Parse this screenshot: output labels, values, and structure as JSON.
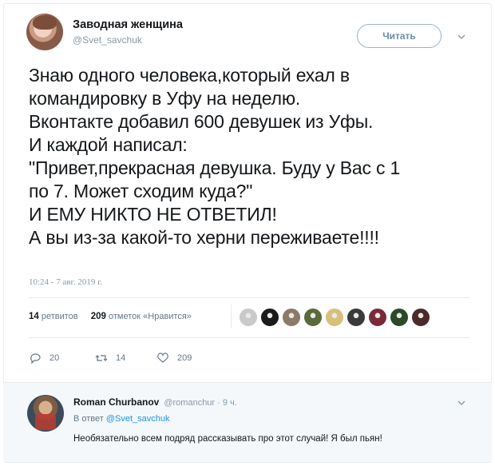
{
  "tweet": {
    "author": {
      "name": "Заводная женщина",
      "handle": "@Svet_savchuk"
    },
    "follow_label": "Читать",
    "text_lines": [
      "Знаю одного человека,который ехал в",
      "командировку в Уфу на неделю.",
      "Вконтакте добавил 600 девушек из Уфы.",
      "И каждой написал:",
      "\"Привет,прекрасная девушка. Буду у Вас с 1",
      "по 7. Может сходим куда?\"",
      "И ЕМУ НИКТО НЕ ОТВЕТИЛ!",
      "А вы из-за какой-то херни переживаете!!!!"
    ],
    "timestamp": "10:24 - 7 авг. 2019 г.",
    "stats": {
      "retweets_count": "14",
      "retweets_label": "ретвитов",
      "likes_count": "209",
      "likes_label": "отметок «Нравится»"
    },
    "likers": [
      {
        "color": "#c9c9c9"
      },
      {
        "color": "#1a1a1a"
      },
      {
        "color": "#8a7a6a"
      },
      {
        "color": "#5a6a3a"
      },
      {
        "color": "#d8c07a"
      },
      {
        "color": "#3a3a3a"
      },
      {
        "color": "#7a2a3a"
      },
      {
        "color": "#2a4a2a"
      },
      {
        "color": "#4a2a2a"
      }
    ],
    "actions": {
      "reply_count": "20",
      "retweet_count": "14",
      "like_count": "209"
    }
  },
  "reply": {
    "name": "Roman Churbanov",
    "handle": "@romanchur",
    "time": "· 9 ч.",
    "reply_to_prefix": "В ответ",
    "reply_to_handle": "@Svet_savchuk",
    "text": "Необязательно всем подряд рассказывать про этот случай! Я был пьян!"
  },
  "colors": {
    "link": "#1b95e0",
    "secondary_text": "#8899a6",
    "border": "#e6ecf0"
  }
}
